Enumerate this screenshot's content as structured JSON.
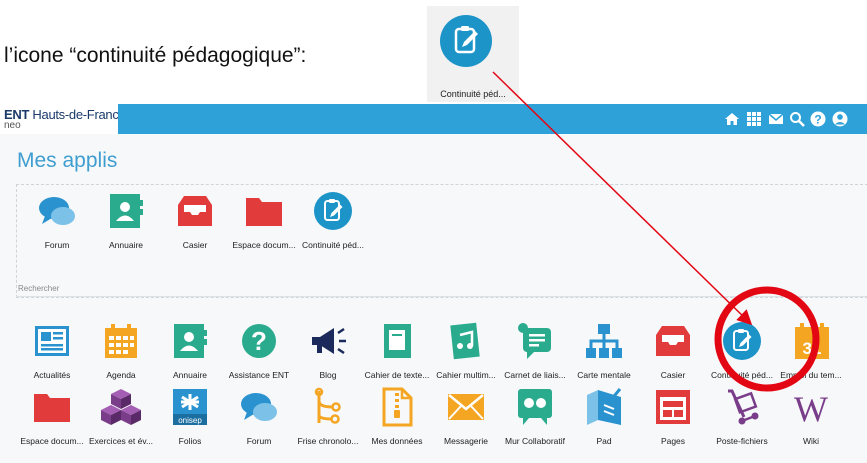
{
  "caption": "l’icone “continuité pédagogique”:",
  "preview_label": "Continuité péd...",
  "header": {
    "logo_bold": "ENT",
    "logo_light": "Hauts-de-France",
    "logo_sub": "neo",
    "icons": [
      "home-icon",
      "apps-grid-icon",
      "mail-icon",
      "search-icon",
      "help-icon",
      "user-icon"
    ]
  },
  "page_title": "Mes applis",
  "search_label": "Rechercher",
  "favorites": [
    {
      "label": "Forum",
      "icon": "forum-icon",
      "color": "#2a93cf"
    },
    {
      "label": "Annuaire",
      "icon": "directory-icon",
      "color": "#2aab8e"
    },
    {
      "label": "Casier",
      "icon": "locker-icon",
      "color": "#e23b3b"
    },
    {
      "label": "Espace docum...",
      "icon": "folder-icon",
      "color": "#e23b3b"
    },
    {
      "label": "Continuité péd...",
      "icon": "continuity-icon",
      "color": "#1d94c8"
    }
  ],
  "apps_row1": [
    {
      "label": "Actualités",
      "icon": "news-icon",
      "color": "#2a93cf"
    },
    {
      "label": "Agenda",
      "icon": "calendar-icon",
      "color": "#f4a521"
    },
    {
      "label": "Annuaire",
      "icon": "directory-icon",
      "color": "#2aab8e"
    },
    {
      "label": "Assistance ENT",
      "icon": "help-icon",
      "color": "#2aab8e"
    },
    {
      "label": "Blog",
      "icon": "megaphone-icon",
      "color": "#1b2a5a"
    },
    {
      "label": "Cahier de texte...",
      "icon": "notebook-icon",
      "color": "#2aab8e"
    },
    {
      "label": "Cahier multim...",
      "icon": "multimedia-icon",
      "color": "#2aab8e"
    },
    {
      "label": "Carnet de liais...",
      "icon": "chat-icon",
      "color": "#2aab8e"
    },
    {
      "label": "Carte mentale",
      "icon": "mindmap-icon",
      "color": "#2a93cf"
    },
    {
      "label": "Casier",
      "icon": "locker-icon",
      "color": "#e23b3b"
    },
    {
      "label": "Continuité péd...",
      "icon": "continuity-icon",
      "color": "#1d94c8"
    },
    {
      "label": "Emploi du tem...",
      "icon": "timetable-icon",
      "color": "#f4a521"
    }
  ],
  "apps_row2": [
    {
      "label": "Espace docum...",
      "icon": "folder-icon",
      "color": "#e23b3b"
    },
    {
      "label": "Exercices et év...",
      "icon": "cubes-icon",
      "color": "#7a3d8a"
    },
    {
      "label": "Folios",
      "icon": "folios-icon",
      "color": "#2a93cf"
    },
    {
      "label": "Forum",
      "icon": "forum-icon",
      "color": "#2a93cf"
    },
    {
      "label": "Frise chronolo...",
      "icon": "timeline-icon",
      "color": "#f4a521"
    },
    {
      "label": "Mes données",
      "icon": "zip-file-icon",
      "color": "#f4a521"
    },
    {
      "label": "Messagerie",
      "icon": "envelope-icon",
      "color": "#f4a521"
    },
    {
      "label": "Mur Collaboratif",
      "icon": "wall-icon",
      "color": "#2aab8e"
    },
    {
      "label": "Pad",
      "icon": "pad-icon",
      "color": "#2a93cf"
    },
    {
      "label": "Pages",
      "icon": "pages-icon",
      "color": "#e23b3b"
    },
    {
      "label": "Poste-fichiers",
      "icon": "cart-icon",
      "color": "#7a3d8a"
    },
    {
      "label": "Wiki",
      "icon": "wiki-icon",
      "color": "#7a3d8a"
    }
  ],
  "folios_tag": "onisep",
  "calendar_day": "31",
  "annotation_color": "#e30613"
}
